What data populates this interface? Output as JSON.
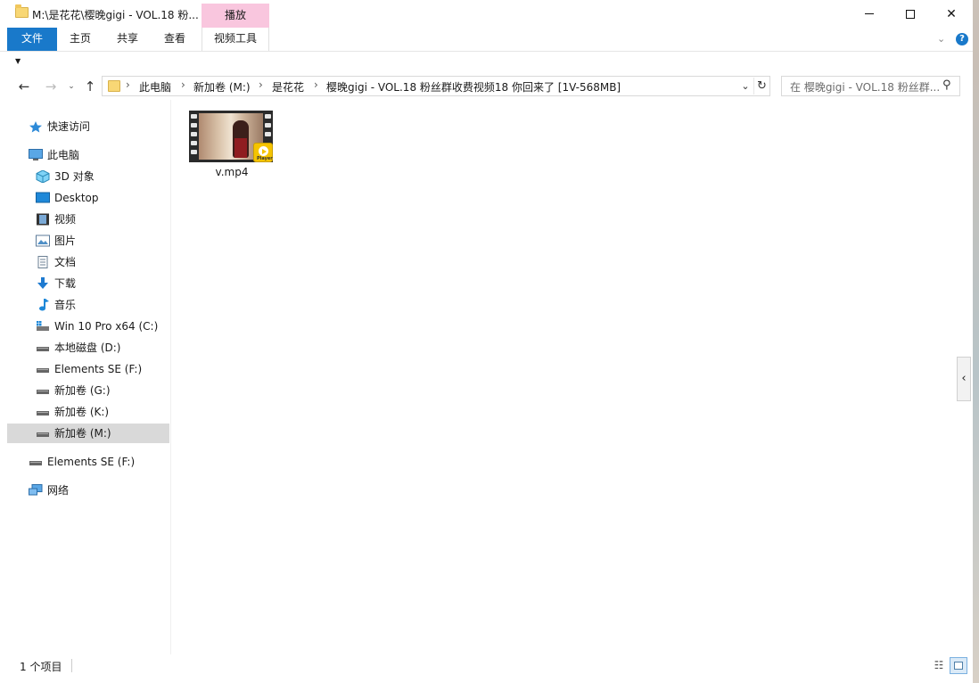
{
  "window": {
    "title": "M:\\是花花\\樱晚gigi - VOL.18 粉...",
    "context_tab_header": "播放",
    "minimize_label": "—",
    "maximize_label": "☐",
    "close_label": "✕"
  },
  "ribbon": {
    "tabs": [
      {
        "label": "文件",
        "active": true
      },
      {
        "label": "主页"
      },
      {
        "label": "共享"
      },
      {
        "label": "查看"
      },
      {
        "label": "视频工具"
      }
    ],
    "accent_color": "#1979ca",
    "context_color": "#f9c6de"
  },
  "address_bar": {
    "crumbs": [
      "此电脑",
      "新加卷 (M:)",
      "是花花",
      "樱晚gigi - VOL.18 粉丝群收费视频18 你回来了 [1V-568MB]"
    ],
    "search_placeholder": "在 樱晚gigi - VOL.18 粉丝群..."
  },
  "nav_pane": {
    "items": [
      {
        "label": "快速访问",
        "icon": "star-icon"
      },
      {
        "label": "此电脑",
        "icon": "computer-icon"
      },
      {
        "label": "3D 对象",
        "icon": "cube-icon"
      },
      {
        "label": "Desktop",
        "icon": "desktop-icon"
      },
      {
        "label": "视频",
        "icon": "video-icon"
      },
      {
        "label": "图片",
        "icon": "picture-icon"
      },
      {
        "label": "文档",
        "icon": "document-icon"
      },
      {
        "label": "下载",
        "icon": "download-icon"
      },
      {
        "label": "音乐",
        "icon": "music-icon"
      },
      {
        "label": "Win 10 Pro x64 (C:)",
        "icon": "system-drive-icon"
      },
      {
        "label": "本地磁盘 (D:)",
        "icon": "drive-icon"
      },
      {
        "label": "Elements SE (F:)",
        "icon": "drive-icon"
      },
      {
        "label": "新加卷 (G:)",
        "icon": "drive-icon"
      },
      {
        "label": "新加卷 (K:)",
        "icon": "drive-icon"
      },
      {
        "label": "新加卷 (M:)",
        "icon": "drive-icon",
        "selected": true
      },
      {
        "label": "Elements SE (F:)",
        "icon": "drive-icon"
      },
      {
        "label": "网络",
        "icon": "network-icon"
      }
    ]
  },
  "files": [
    {
      "name": "v.mp4",
      "badge": "Player"
    }
  ],
  "status_bar": {
    "item_count": "1 个项目"
  }
}
